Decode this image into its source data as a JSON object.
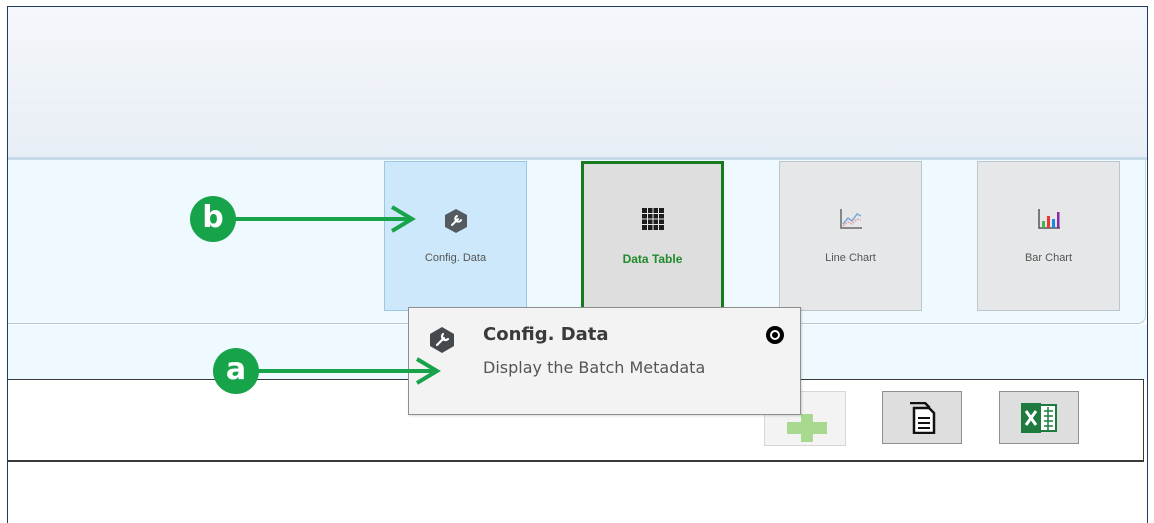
{
  "ribbon": {
    "buttons": [
      {
        "label": "Config. Data",
        "icon": "hexagon-wrench-icon",
        "state": "hovered"
      },
      {
        "label": "Data Table",
        "icon": "grid-table-icon",
        "state": "selected"
      },
      {
        "label": "Line Chart",
        "icon": "line-chart-icon",
        "state": "normal"
      },
      {
        "label": "Bar Chart",
        "icon": "bar-chart-icon",
        "state": "normal"
      }
    ]
  },
  "tooltip": {
    "title": "Config. Data",
    "description": "Display the Batch Metadata",
    "icon": "hexagon-wrench-icon",
    "pin_icon": "pin-circle-icon"
  },
  "toolbar": {
    "buttons": [
      {
        "name": "add",
        "icon": "plus-icon",
        "state": "disabled"
      },
      {
        "name": "copy",
        "icon": "copy-document-icon",
        "state": "normal"
      },
      {
        "name": "export-excel",
        "icon": "excel-icon",
        "state": "normal"
      }
    ]
  },
  "annotations": [
    {
      "label": "b",
      "color": "#17a34a"
    },
    {
      "label": "a",
      "color": "#17a34a"
    }
  ],
  "colors": {
    "accent_green": "#17a34a",
    "selected_border": "#177a1f",
    "hover_blue": "#cce8fa",
    "ribbon_bg": "#eefaff"
  }
}
